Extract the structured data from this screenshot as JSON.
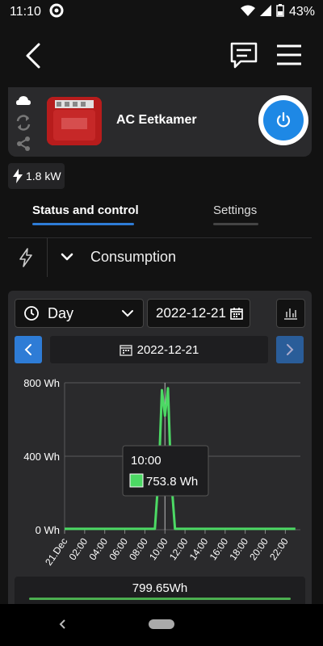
{
  "status_bar": {
    "time": "11:10",
    "battery": "43%"
  },
  "device": {
    "name": "AC Eetkamer",
    "power_reading": "1.8 kW"
  },
  "tabs": [
    {
      "label": "Status and control",
      "active": true
    },
    {
      "label": "Settings",
      "active": false
    }
  ],
  "consumption": {
    "title": "Consumption"
  },
  "controls": {
    "period": "Day",
    "date_value": "2022-12-21",
    "nav_date": "2022-12-21"
  },
  "tooltip": {
    "time": "10:00",
    "value": "753.8 Wh"
  },
  "total": {
    "value": "799.65Wh"
  },
  "colors": {
    "accent": "#2e7cd6",
    "series": "#4cd964",
    "power": "#1e88e5"
  },
  "chart_data": {
    "type": "line",
    "y_tick_labels": [
      "800 Wh",
      "400 Wh",
      "0 Wh"
    ],
    "y_ticks": [
      800,
      400,
      0
    ],
    "ylim": [
      0,
      800
    ],
    "x_tick_labels": [
      "21.Dec",
      "02:00",
      "04:00",
      "06:00",
      "08:00",
      "10:00",
      "12:00",
      "14:00",
      "16:00",
      "18:00",
      "20:00",
      "22:00"
    ],
    "x_ticks": [
      0,
      2,
      4,
      6,
      8,
      10,
      12,
      14,
      16,
      18,
      20,
      22
    ],
    "xlim": [
      0,
      23.5
    ],
    "x": [
      0,
      1,
      2,
      3,
      4,
      5,
      6,
      7,
      8,
      9,
      9.4,
      9.7,
      10,
      10.3,
      10.6,
      11,
      12,
      13,
      14,
      15,
      16,
      17,
      18,
      19,
      20,
      21,
      22,
      23
    ],
    "y": [
      5,
      5,
      5,
      5,
      5,
      5,
      5,
      5,
      5,
      5,
      320,
      760,
      620,
      770,
      300,
      5,
      5,
      5,
      5,
      5,
      5,
      5,
      5,
      5,
      5,
      5,
      5,
      5
    ],
    "grid": true,
    "highlight_x": 10
  }
}
